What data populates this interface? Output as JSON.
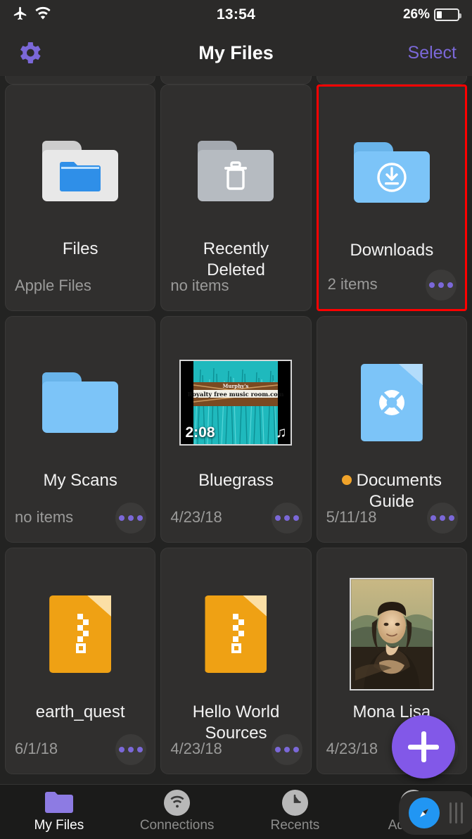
{
  "status_bar": {
    "airplane_icon": "airplane-mode-icon",
    "wifi_icon": "wifi-icon",
    "time": "13:54",
    "battery_percent": "26%",
    "battery_level": 26
  },
  "nav_bar": {
    "settings_icon": "gear-icon",
    "title": "My Files",
    "select_label": "Select",
    "accent_color": "#7b68d8"
  },
  "grid": {
    "items": [
      {
        "name": "Files",
        "meta": "Apple Files",
        "icon": "white-folder-with-blue-folder-icon",
        "icon_kind": "folder",
        "folder_color": "#e8e8e8",
        "has_more": false,
        "highlighted": false,
        "dot_color": null
      },
      {
        "name": "Recently Deleted",
        "meta": "no items",
        "icon": "gray-folder-trash-icon",
        "icon_kind": "folder",
        "folder_color": "#b6bbc1",
        "has_more": false,
        "highlighted": false,
        "dot_color": null
      },
      {
        "name": "Downloads",
        "meta": "2 items",
        "icon": "blue-folder-download-icon",
        "icon_kind": "folder",
        "folder_color": "#7cc4f8",
        "has_more": true,
        "highlighted": true,
        "dot_color": null
      },
      {
        "name": "My Scans",
        "meta": "no items",
        "icon": "blue-folder-icon",
        "icon_kind": "folder",
        "folder_color": "#7cc4f8",
        "has_more": true,
        "highlighted": false,
        "dot_color": null
      },
      {
        "name": "Bluegrass",
        "meta": "4/23/18",
        "icon": "audio-thumbnail",
        "icon_kind": "media",
        "duration": "2:08",
        "note_icon": "music-note-icon",
        "banner_text": "Royalty free music room.com",
        "has_more": true,
        "highlighted": false,
        "dot_color": null
      },
      {
        "name": "Documents Guide",
        "meta": "5/11/18",
        "icon": "blue-document-lifering-icon",
        "icon_kind": "doc",
        "doc_color": "#7cc4f8",
        "has_more": true,
        "highlighted": false,
        "dot_color": "#f0a32a"
      },
      {
        "name": "earth_quest",
        "meta": "6/1/18",
        "icon": "orange-zip-document-icon",
        "icon_kind": "doc",
        "doc_color": "#efa114",
        "has_more": true,
        "highlighted": false,
        "dot_color": null
      },
      {
        "name": "Hello World Sources",
        "meta": "4/23/18",
        "icon": "orange-zip-document-icon",
        "icon_kind": "doc",
        "doc_color": "#efa114",
        "has_more": true,
        "highlighted": false,
        "dot_color": null
      },
      {
        "name": "Mona Lisa",
        "meta": "4/23/18",
        "icon": "mona-lisa-image-thumbnail",
        "icon_kind": "photo",
        "has_more": true,
        "highlighted": false,
        "dot_color": null
      }
    ]
  },
  "fab": {
    "icon": "plus-icon",
    "color": "#8258e8"
  },
  "tab_bar": {
    "tabs": [
      {
        "label": "My Files",
        "icon": "purple-folder-icon",
        "active": true
      },
      {
        "label": "Connections",
        "icon": "wifi-icon",
        "active": false
      },
      {
        "label": "Recents",
        "icon": "clock-icon",
        "active": false
      },
      {
        "label": "Add-ons",
        "icon": "shopping-cart-icon",
        "active": false
      }
    ]
  },
  "slide_over": {
    "app_icon": "safari-compass-icon",
    "handle": "drag-handle-icon"
  },
  "highlight_color": "#ff0000"
}
